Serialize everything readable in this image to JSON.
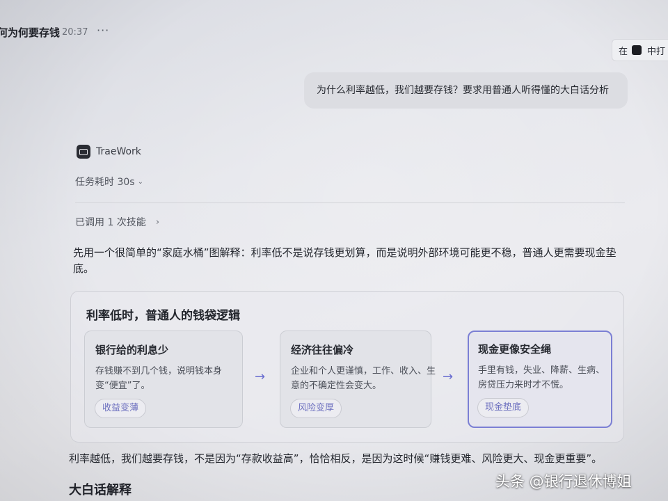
{
  "header": {
    "title": "何为何要存钱",
    "time": "20:37",
    "more_icon": "more-horizontal-icon",
    "chip_prefix": "在",
    "chip_label": "中打"
  },
  "conversation": {
    "user_message": "为什么利率越低，我们越要存钱？要求用普通人听得懂的大白话分析",
    "bot_name": "TraeWork",
    "elapsed": "任务耗时 30s",
    "skills": "已调用 1 次技能",
    "intro": "先用一个很简单的“家庭水桶”图解释：利率低不是说存钱更划算，而是说明外部环境可能更不稳，普通人更需要现金垫底。",
    "card": {
      "title": "利率低时，普通人的钱袋逻辑",
      "steps": [
        {
          "title": "银行给的利息少",
          "desc": "存钱赚不到几个钱，说明钱本身变“便宜”了。",
          "tag": "收益变薄"
        },
        {
          "title": "经济往往偏冷",
          "desc": "企业和个人更谨慎，工作、收入、生意的不确定性会变大。",
          "tag": "风险变厚"
        },
        {
          "title": "现金更像安全绳",
          "desc": "手里有钱，失业、降薪、生病、房贷压力来时才不慌。",
          "tag": "现金垫底"
        }
      ],
      "arrow": "→"
    },
    "outro": "利率越低，我们越要存钱，不是因为“存款收益高”，恰恰相反，是因为这时候“赚钱更难、风险更大、现金更重要”。",
    "section_heading": "大白话解释"
  },
  "watermark": "头条 @银行退休博姐",
  "colors": {
    "accent": "#7b7fd4",
    "tag_text": "#6c6fbf",
    "bubble": "#dcdde2"
  }
}
